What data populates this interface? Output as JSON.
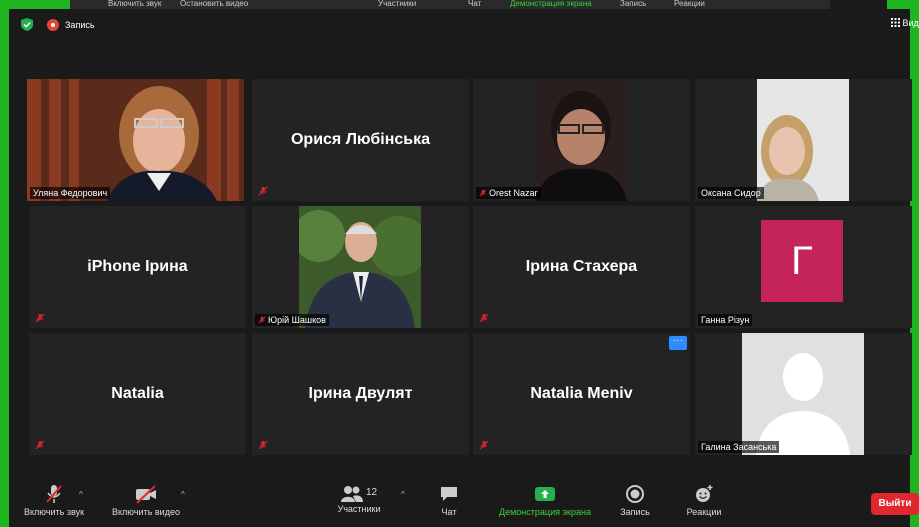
{
  "share_bar": {
    "items": [
      "Включить звук",
      "Остановить видео",
      "Участники",
      "Чат",
      "Демонстрация экрана",
      "Запись",
      "Реакции"
    ]
  },
  "top": {
    "recording_label": "Запись",
    "view_label": "Вид"
  },
  "tiles": [
    {
      "name": "Уляна Федорович",
      "type": "video"
    },
    {
      "name": "Орися Любінська",
      "type": "text"
    },
    {
      "name": "Orest Nazar",
      "type": "video"
    },
    {
      "name": "Оксана Сидор",
      "type": "video"
    },
    {
      "name": "iPhone Ірина",
      "type": "text"
    },
    {
      "name": "Юрій Шашков",
      "type": "video"
    },
    {
      "name": "Ірина Стахера",
      "type": "text"
    },
    {
      "name": "Ганна Різун",
      "type": "avatar",
      "initial": "Г"
    },
    {
      "name": "Natalia",
      "type": "text"
    },
    {
      "name": "Ірина Двулят",
      "type": "text"
    },
    {
      "name": "Natalia Meniv",
      "type": "text",
      "more": "···"
    },
    {
      "name": "Галина Засанська",
      "type": "avatar-silhouette"
    }
  ],
  "toolbar": {
    "unmute": "Включить звук",
    "start_video": "Включить видео",
    "participants": "Участники",
    "participants_count": "12",
    "chat": "Чат",
    "share": "Демонстрация экрана",
    "record": "Запись",
    "reactions": "Реакции",
    "leave": "Выйти"
  },
  "colors": {
    "share_green": "#1fb51f",
    "active_speaker": "#d8d94a",
    "leave_red": "#e0262f",
    "avatar_pink": "#c4245b"
  }
}
